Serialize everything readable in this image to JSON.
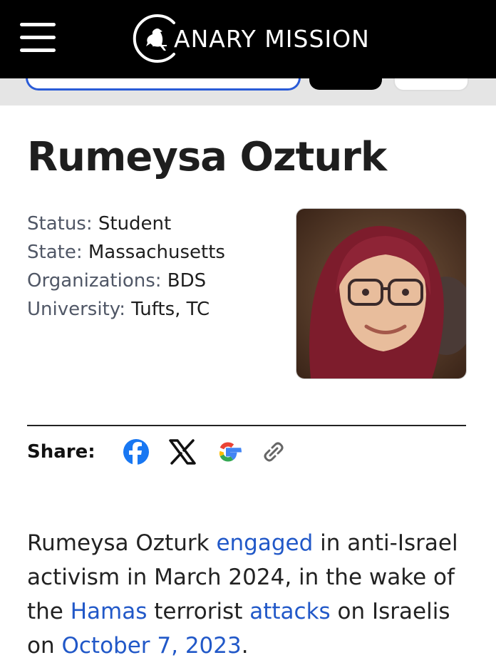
{
  "header": {
    "logo_text": "ANARY MISSION",
    "menu_icon": "hamburger-menu-icon",
    "logo_icon": "canary-bird-icon"
  },
  "profile": {
    "name": "Rumeysa Ozturk",
    "facts": [
      {
        "label": "Status:",
        "value": "Student"
      },
      {
        "label": "State:",
        "value": "Massachusetts"
      },
      {
        "label": "Organizations:",
        "value": "BDS"
      },
      {
        "label": "University:",
        "value": "Tufts, TC"
      }
    ]
  },
  "share": {
    "label": "Share:",
    "icons": [
      "facebook-icon",
      "x-icon",
      "google-icon",
      "link-icon"
    ]
  },
  "bio": {
    "t1": "Rumeysa Ozturk ",
    "l1": "engaged",
    "t2": " in anti-Israel activism in March 2024, in the wake of the ",
    "l2": "Hamas",
    "t3": " terrorist ",
    "l3": "attacks",
    "t4": " on Israelis on ",
    "l4": "October 7, 2023",
    "t5": "."
  },
  "colors": {
    "link": "#2158c8",
    "label": "#505766",
    "header_bg": "#000000",
    "search_border": "#2a5bd7"
  }
}
